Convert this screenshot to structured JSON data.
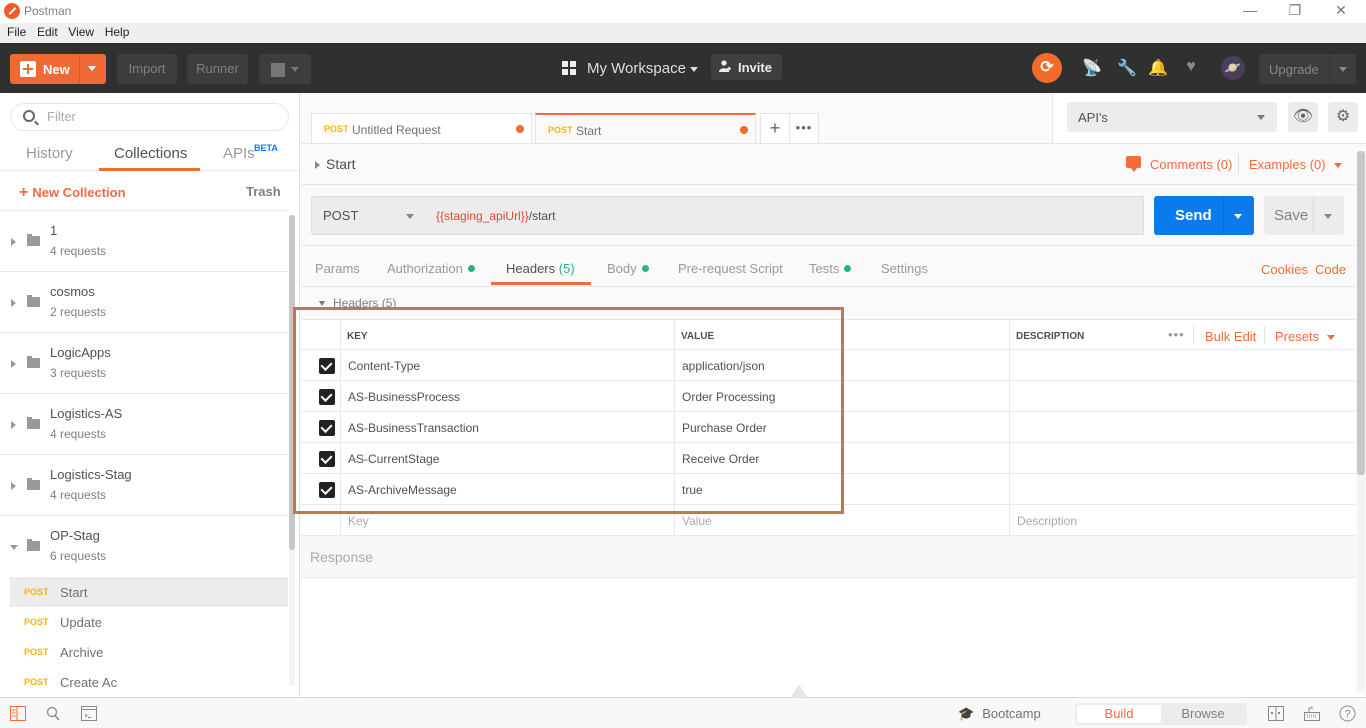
{
  "window": {
    "title": "Postman",
    "controls": {
      "minimize": "—",
      "restore": "❐",
      "close": "✕"
    }
  },
  "menu": [
    "File",
    "Edit",
    "View",
    "Help"
  ],
  "toolbar": {
    "new_label": "New",
    "import_label": "Import",
    "runner_label": "Runner",
    "workspace_label": "My Workspace",
    "invite_label": "Invite",
    "upgrade_label": "Upgrade",
    "icons": [
      "sync-icon",
      "satellite-icon",
      "wrench-icon",
      "bell-icon",
      "heart-icon",
      "avatar-icon"
    ]
  },
  "sidebar": {
    "filter_placeholder": "Filter",
    "tabs": [
      {
        "label": "History",
        "active": false
      },
      {
        "label": "Collections",
        "active": true
      },
      {
        "label": "APIs",
        "badge": "BETA",
        "active": false
      }
    ],
    "new_collection_label": "New Collection",
    "trash_label": "Trash",
    "collections": [
      {
        "name": "1",
        "count": "4 requests",
        "expanded": false
      },
      {
        "name": "cosmos",
        "count": "2 requests",
        "expanded": false
      },
      {
        "name": "LogicApps",
        "count": "3 requests",
        "expanded": false
      },
      {
        "name": "Logistics-AS",
        "count": "4 requests",
        "expanded": false
      },
      {
        "name": "Logistics-Stag",
        "count": "4 requests",
        "expanded": false
      },
      {
        "name": "OP-Stag",
        "count": "6 requests",
        "expanded": true
      }
    ],
    "requests": [
      {
        "method": "POST",
        "name": "Start",
        "active": true
      },
      {
        "method": "POST",
        "name": "Update",
        "active": false
      },
      {
        "method": "POST",
        "name": "Archive",
        "active": false
      },
      {
        "method": "POST",
        "name": "Create Ac",
        "active": false
      }
    ]
  },
  "tabs": [
    {
      "method": "POST",
      "name": "Untitled Request",
      "unsaved": true,
      "active": false
    },
    {
      "method": "POST",
      "name": "Start",
      "unsaved": true,
      "active": true
    }
  ],
  "environment": {
    "selected": "API's"
  },
  "request": {
    "name": "Start",
    "comments_label": "Comments (0)",
    "examples_label": "Examples (0)",
    "method": "POST",
    "url_variable": "{{staging_apiUrl}}",
    "url_path": "/start",
    "send_label": "Send",
    "save_label": "Save",
    "subtabs": [
      {
        "label": "Params",
        "dot": false
      },
      {
        "label": "Authorization",
        "dot": true
      },
      {
        "label": "Headers",
        "count": "(5)",
        "active": true
      },
      {
        "label": "Body",
        "dot": true
      },
      {
        "label": "Pre-request Script",
        "dot": false
      },
      {
        "label": "Tests",
        "dot": true
      },
      {
        "label": "Settings",
        "dot": false
      }
    ],
    "cookies_label": "Cookies",
    "code_label": "Code"
  },
  "headers": {
    "section_label": "Headers (5)",
    "columns": {
      "key": "KEY",
      "value": "VALUE",
      "description": "DESCRIPTION"
    },
    "bulk_edit_label": "Bulk Edit",
    "presets_label": "Presets",
    "more_label": "•••",
    "rows": [
      {
        "enabled": true,
        "key": "Content-Type",
        "value": "application/json",
        "description": ""
      },
      {
        "enabled": true,
        "key": "AS-BusinessProcess",
        "value": "Order Processing",
        "description": ""
      },
      {
        "enabled": true,
        "key": "AS-BusinessTransaction",
        "value": "Purchase Order",
        "description": ""
      },
      {
        "enabled": true,
        "key": "AS-CurrentStage",
        "value": "Receive Order",
        "description": ""
      },
      {
        "enabled": true,
        "key": "AS-ArchiveMessage",
        "value": "true",
        "description": ""
      }
    ],
    "placeholders": {
      "key": "Key",
      "value": "Value",
      "description": "Description"
    }
  },
  "response": {
    "label": "Response"
  },
  "statusbar": {
    "bootcamp_label": "Bootcamp",
    "build_label": "Build",
    "browse_label": "Browse",
    "active_mode": "Build"
  },
  "colors": {
    "accent": "#f26b3a",
    "send_blue": "#097bed",
    "method_post": "#fdb300",
    "status_green": "#26b47f",
    "variable_red": "#e0492e",
    "annotation_box": "#b87a58"
  }
}
